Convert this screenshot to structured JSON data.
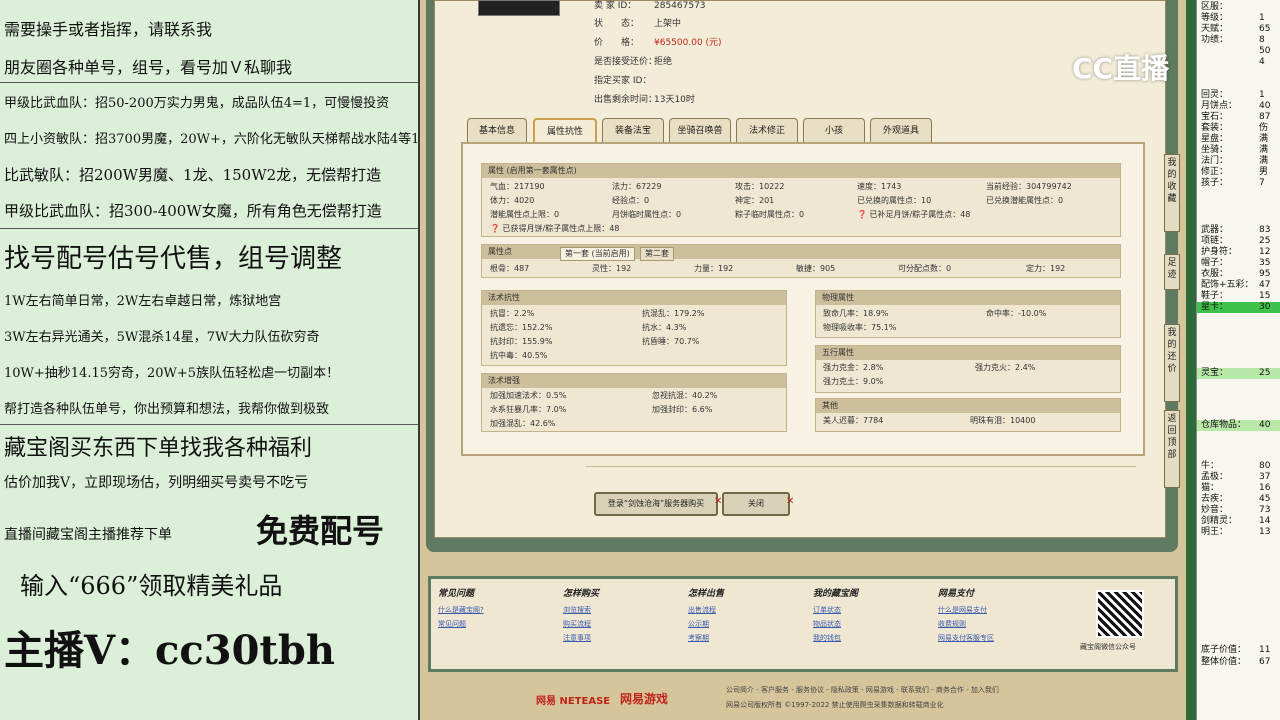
{
  "left_panel": {
    "lines": [
      "需要操手或者指挥，请联系我",
      "朋友圈各种单号，组号，看号加Ｖ私聊我",
      "甲级比武血队：招50-200万实力男鬼，成品队伍4=1，可慢慢投资",
      "四上小资敏队：招3700男魔，20W+，六阶化无敏队天梯帮战水陆4等1",
      "比武敏队：招200W男魔、1龙、150W2龙，无偿帮打造",
      "甲级比武血队：招300-400W女魔，所有角色无偿帮打造",
      "找号配号估号代售，组号调整",
      "1W左右简单日常，2W左右卓越日常，炼狱地宫",
      "3W左右异光通关，5W混杀14星，7W大力队伍砍穷奇",
      "10W+抽秒14.15穷奇，20W+5族队伍轻松虐一切副本！",
      "帮打造各种队伍单号，你出预算和想法，我帮你做到极致",
      "藏宝阁买东西下单找我各种福利",
      "估价加我V，立即现场估，列明细买号卖号不吃亏",
      "直播间藏宝阁主播推荐下单",
      "免费配号",
      "输入“666”领取精美礼品",
      "主播V：cc30tbh"
    ]
  },
  "logo": {
    "text": "CC直播"
  },
  "item_info": {
    "seller_id_label": "卖 家 ID：",
    "seller_id": "285467573",
    "status_label": "状　　态：",
    "status": "上架中",
    "price_label": "价　　格：",
    "price": "¥65500.00 (元)",
    "counter_label": "是否接受还价：",
    "counter": "拒绝",
    "buyer_label": "指定买家 ID：",
    "remain_label": "出售剩余时间：",
    "remain": "13天10时"
  },
  "tabs": [
    "基本信息",
    "属性抗性",
    "装备法宝",
    "坐骑召唤兽",
    "法术修正",
    "小孩",
    "外观道具"
  ],
  "attr_section": {
    "title": "属性 (启用第一套属性点)",
    "rows": [
      [
        "气血：217190",
        "法力：67229",
        "攻击：10222",
        "速度：1743",
        "当前经验：304799742"
      ],
      [
        "体力：4020",
        "经验点：0",
        "神定：201",
        "已兑换的属性点：10",
        "已兑换潜能属性点：0"
      ],
      [
        "潜能属性点上限：0",
        "月饼临时属性点：0",
        "粽子临时属性点：0",
        "已补足月饼/粽子属性点：48"
      ]
    ],
    "note": "已获得月饼/粽子属性点上限：48"
  },
  "points_section": {
    "title": "属性点",
    "sub_tabs": [
      "第一套 (当前启用)",
      "第二套"
    ],
    "values": [
      "根骨：487",
      "灵性：192",
      "力量：192",
      "敏捷：905",
      "可分配点数：0",
      "定力：192"
    ]
  },
  "resist_section": {
    "title": "法术抗性",
    "cells": [
      "抗冒：2.2%",
      "抗混乱：179.2%",
      "抗遗忘：152.2%",
      "抗水：4.3%",
      "抗封印：155.9%",
      "抗昏睡：70.7%",
      "抗中毒：40.5%"
    ]
  },
  "enhance_section": {
    "title": "法术增强",
    "cells": [
      "加强加速法术：0.5%",
      "忽视抗混：40.2%",
      "水系狂暴几率：7.0%",
      "加强封印：6.6%",
      "加强混乱：42.6%"
    ]
  },
  "phys_section": {
    "title": "物理属性",
    "cells": [
      "致命几率：18.9%",
      "命中率：-10.0%",
      "物理吸收率：75.1%"
    ]
  },
  "five_section": {
    "title": "五行属性",
    "cells": [
      "强力克金：2.8%",
      "强力克火：2.4%",
      "强力克土：9.0%"
    ]
  },
  "other_section": {
    "title": "其他",
    "cells": [
      "美人迟暮：7784",
      "明珠有泪：10400"
    ]
  },
  "buttons": {
    "buy": "登录“剑蚀沧海”服务器购买",
    "close": "关闭"
  },
  "side_tabs": [
    "我的收藏",
    "足迹",
    "我的还价",
    "返回顶部"
  ],
  "footer": {
    "cols": [
      {
        "head": "常见问题",
        "links": [
          "什么是藏宝阁?",
          "常见问题"
        ]
      },
      {
        "head": "怎样购买",
        "links": [
          "浏览搜索",
          "购买流程",
          "注意事项"
        ]
      },
      {
        "head": "怎样出售",
        "links": [
          "出售流程",
          "公示期",
          "考察期"
        ]
      },
      {
        "head": "我的藏宝阁",
        "links": [
          "订单状态",
          "物品状态",
          "我的钱包"
        ]
      },
      {
        "head": "网易支付",
        "links": [
          "什么是网易支付",
          "收费规则",
          "网易支付客服专区"
        ]
      }
    ],
    "qr_caption": "藏宝阁微信公众号"
  },
  "bottom": {
    "brand1": "网易 NETEASE",
    "brand2": "网易游戏",
    "links": "公司简介 - 客户服务 - 服务协议 - 隐私政策 - 网易游戏 - 联系我们 - 商务合作 - 加入我们",
    "copyright": "网易公司版权所有 ©1997-2022 禁止使用爬虫采集数据和转载商业化"
  },
  "right_panel": {
    "rows": [
      [
        "区服：",
        ""
      ],
      [
        "等级：",
        "1"
      ],
      [
        "天赋：",
        "65"
      ],
      [
        "功绩：",
        "8"
      ],
      [
        "",
        "50"
      ],
      [
        "",
        "4"
      ],
      [
        "",
        ""
      ],
      [
        "",
        ""
      ],
      [
        "回灵：",
        "1"
      ],
      [
        "月饼点：",
        "40"
      ],
      [
        "宝石：",
        "87"
      ],
      [
        "套装：",
        "伤"
      ],
      [
        "星盘：",
        "满"
      ],
      [
        "坐骑：",
        "满"
      ],
      [
        "法门：",
        "满"
      ],
      [
        "修正：",
        "男"
      ],
      [
        "孩子：",
        "7"
      ]
    ],
    "rows2": [
      [
        "武器：",
        "83"
      ],
      [
        "项链：",
        "25"
      ],
      [
        "护身符：",
        "12"
      ],
      [
        "帽子：",
        "35"
      ],
      [
        "衣服：",
        "95"
      ],
      [
        "配饰+五彩：",
        "47"
      ],
      [
        "鞋子：",
        "15"
      ],
      [
        "星卡：",
        "30"
      ]
    ],
    "lingbao": [
      "灵宝：",
      "25"
    ],
    "cangku": [
      "仓库物品：",
      "40"
    ],
    "rows3": [
      [
        "牛：",
        "80"
      ],
      [
        "孟极：",
        "37"
      ],
      [
        "猫：",
        "16"
      ],
      [
        "去疾：",
        "45"
      ],
      [
        "妙音：",
        "73"
      ],
      [
        "剑精灵：",
        "14"
      ],
      [
        "明王：",
        "13"
      ]
    ],
    "base_value": [
      "底子价值：",
      "11"
    ],
    "total_value": [
      "整体价值：",
      "67"
    ]
  }
}
